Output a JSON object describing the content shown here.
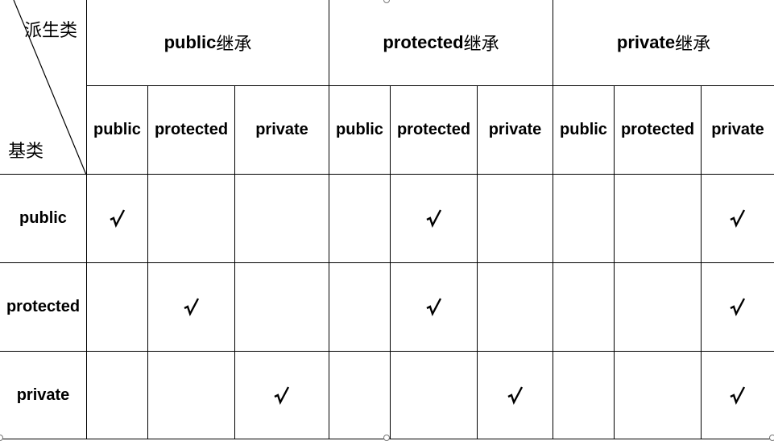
{
  "corner": {
    "derived_label": "派生类",
    "base_label": "基类"
  },
  "groups": [
    {
      "mode": "public",
      "suffix": "继承"
    },
    {
      "mode": "protected",
      "suffix": "继承"
    },
    {
      "mode": "private",
      "suffix": "继承"
    }
  ],
  "sub_headers": [
    "public",
    "protected",
    "private",
    "public",
    "protected",
    "private",
    "public",
    "protected",
    "private"
  ],
  "rows": [
    {
      "label": "public",
      "checks": [
        true,
        false,
        false,
        false,
        true,
        false,
        false,
        false,
        true
      ]
    },
    {
      "label": "protected",
      "checks": [
        false,
        true,
        false,
        false,
        true,
        false,
        false,
        false,
        true
      ]
    },
    {
      "label": "private",
      "checks": [
        false,
        false,
        true,
        false,
        false,
        true,
        false,
        false,
        true
      ]
    }
  ],
  "check_symbol": "√"
}
